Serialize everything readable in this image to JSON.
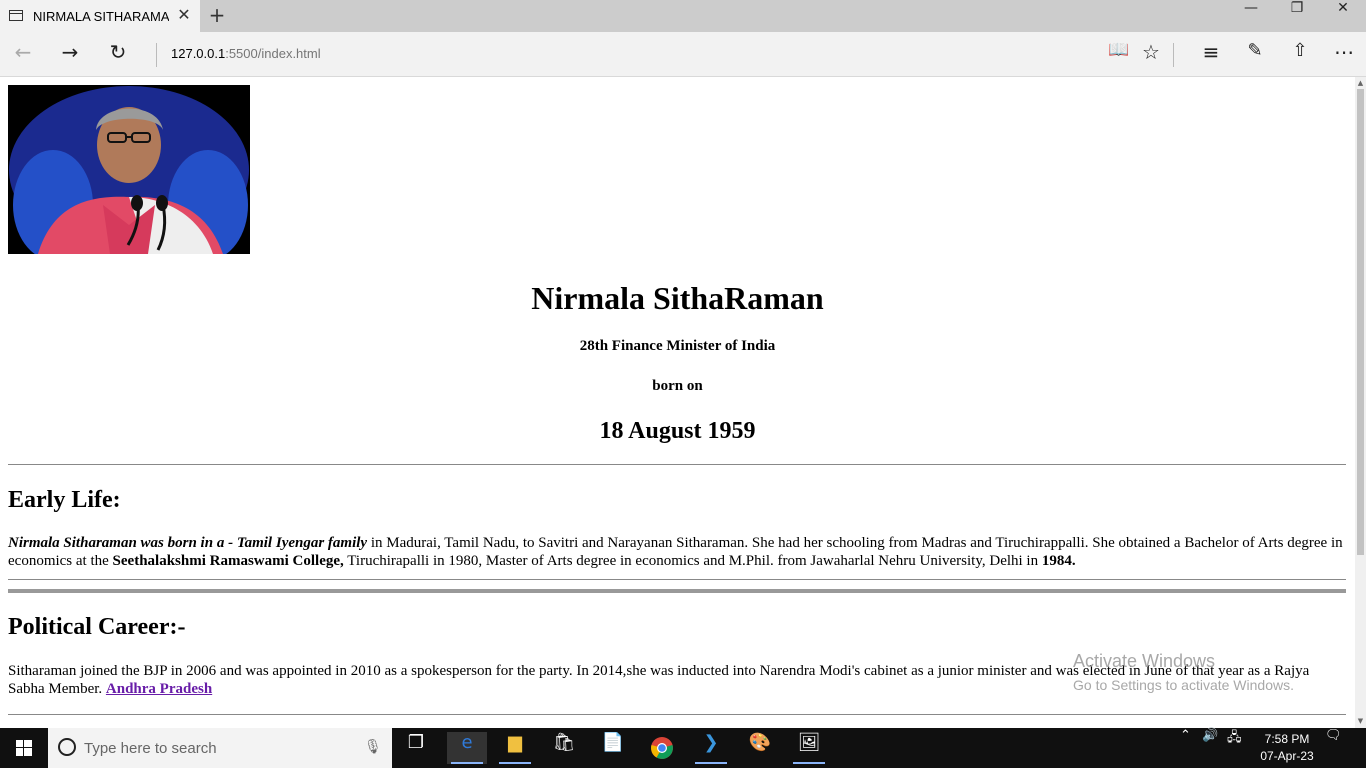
{
  "browser": {
    "tab_title": "NIRMALA SITHARAMAN",
    "url_host": "127.0.0.1",
    "url_rest": ":5500/index.html"
  },
  "page": {
    "image_alt": "Nirmala Sitharaman portrait",
    "title": "Nirmala SithaRaman",
    "subtitle": "28th Finance Minister of India",
    "born_label": "born on",
    "born_date": "18 August 1959",
    "early_life": {
      "heading": "Early Life:",
      "emphasis": "Nirmala Sitharaman was born in a - Tamil Iyengar family",
      "text1": " in Madurai, Tamil Nadu, to Savitri and Narayanan Sitharaman. She had her schooling from Madras and Tiruchirappalli. She obtained a Bachelor of Arts degree in economics at the ",
      "college": "Seethalakshmi Ramaswami College,",
      "text2": " Tiruchirapalli in 1980, Master of Arts degree in economics and M.Phil. from Jawaharlal Nehru University, Delhi in ",
      "year": "1984."
    },
    "political_career": {
      "heading": "Political Career:-",
      "text": "Sitharaman joined the BJP in 2006 and was appointed in 2010 as a spokesperson for the party. In 2014,she was inducted into Narendra Modi's cabinet as a junior minister and was elected in June of that year as a Rajya Sabha Member. ",
      "link": "Andhra Pradesh"
    }
  },
  "watermark": {
    "line1": "Activate Windows",
    "line2": "Go to Settings to activate Windows."
  },
  "taskbar": {
    "search_placeholder": "Type here to search",
    "time": "7:58 PM",
    "date": "07-Apr-23"
  }
}
